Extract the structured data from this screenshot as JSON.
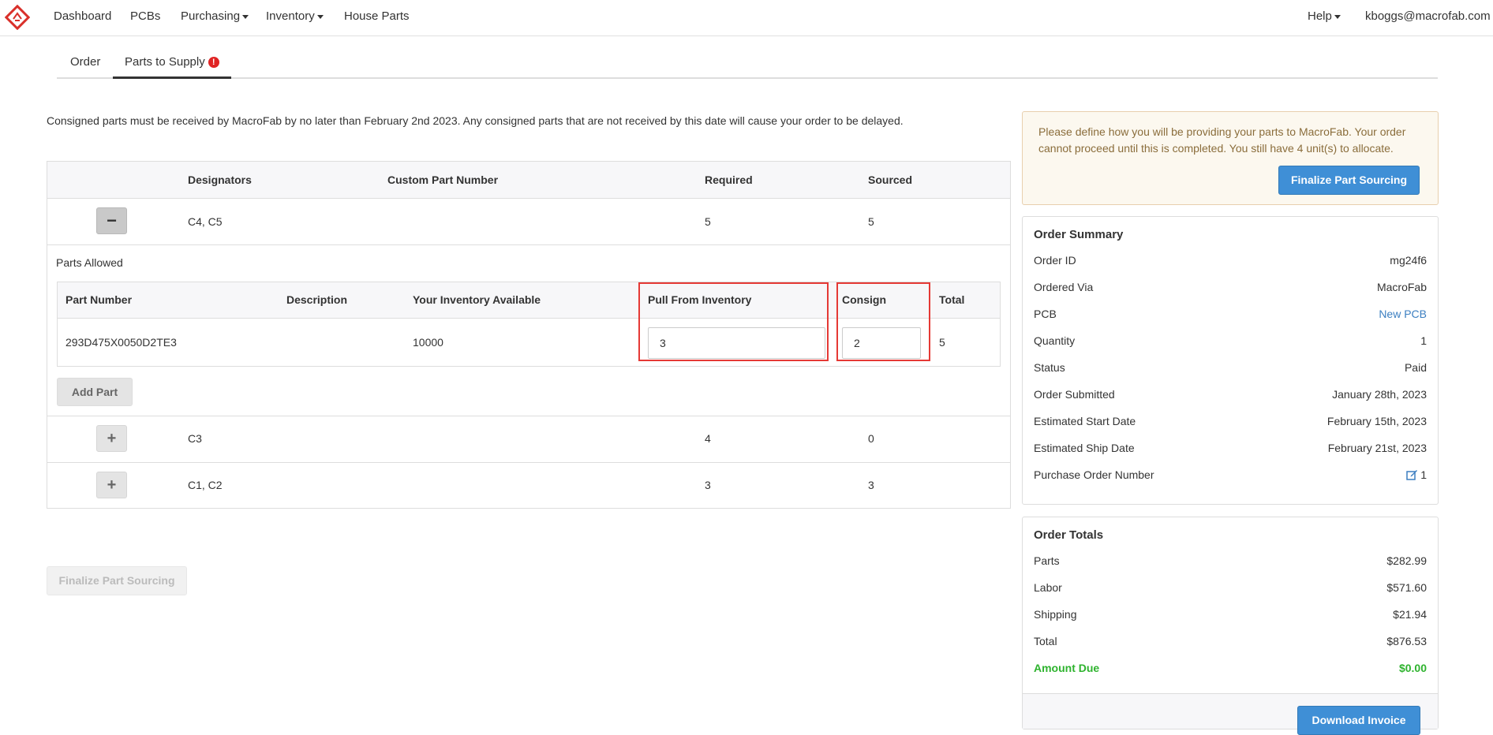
{
  "nav": {
    "items": [
      {
        "label": "Dashboard"
      },
      {
        "label": "PCBs"
      },
      {
        "label": "Purchasing"
      },
      {
        "label": "Inventory"
      },
      {
        "label": "House Parts"
      }
    ],
    "help": "Help",
    "user": "kboggs@macrofab.com"
  },
  "tabs": [
    {
      "label": "Order"
    },
    {
      "label": "Parts to Supply",
      "alert": "!"
    }
  ],
  "notice": "Consigned parts must be received by MacroFab by no later than February 2nd 2023.  Any consigned parts that are not received by this date will cause your order to be delayed.",
  "parts_table": {
    "headers": [
      "Designators",
      "Custom Part Number",
      "Required",
      "Sourced"
    ],
    "rows": [
      {
        "toggle": "−",
        "designators": "C4, C5",
        "custom_part_number": "",
        "required": "5",
        "sourced": "5"
      },
      {
        "toggle": "+",
        "designators": "C3",
        "custom_part_number": "",
        "required": "4",
        "sourced": "0"
      },
      {
        "toggle": "+",
        "designators": "C1, C2",
        "custom_part_number": "",
        "required": "3",
        "sourced": "3"
      }
    ],
    "parts_allowed_label": "Parts Allowed",
    "inner_headers": [
      "Part Number",
      "Description",
      "Your Inventory Available",
      "Pull From Inventory",
      "Consign",
      "Total"
    ],
    "inner_row": {
      "part_number": "293D475X0050D2TE3",
      "description": "",
      "inventory_available": "10000",
      "pull_from_inventory": "3",
      "consign": "2",
      "total": "5"
    },
    "add_part_label": "Add Part"
  },
  "finalize_disabled_label": "Finalize Part Sourcing",
  "warning": {
    "text": "Please define how you will be providing your parts to MacroFab. Your order cannot proceed until this is completed. You still have 4 unit(s) to allocate.",
    "button": "Finalize Part Sourcing"
  },
  "order_summary": {
    "title": "Order Summary",
    "rows": [
      {
        "key": "Order ID",
        "value": "mg24f6"
      },
      {
        "key": "Ordered Via",
        "value": "MacroFab"
      },
      {
        "key": "PCB",
        "value": "New PCB"
      },
      {
        "key": "Quantity",
        "value": "1"
      },
      {
        "key": "Status",
        "value": "Paid"
      },
      {
        "key": "Order Submitted",
        "value": "January 28th, 2023"
      },
      {
        "key": "Estimated Start Date",
        "value": "February 15th, 2023"
      },
      {
        "key": "Estimated Ship Date",
        "value": "February 21st, 2023"
      },
      {
        "key": "Purchase Order Number",
        "value": "1"
      }
    ]
  },
  "order_totals": {
    "title": "Order Totals",
    "rows": [
      {
        "key": "Parts",
        "value": "$282.99"
      },
      {
        "key": "Labor",
        "value": "$571.60"
      },
      {
        "key": "Shipping",
        "value": "$21.94"
      },
      {
        "key": "Total",
        "value": "$876.53"
      },
      {
        "key": "Amount Due",
        "value": "$0.00"
      }
    ],
    "download_button": "Download Invoice"
  },
  "colors": {
    "accent": "#3f8fd6",
    "alert": "#e02424",
    "highlight": "#e53935",
    "success": "#2eb32e",
    "warning_text": "#8a6d3b"
  },
  "icons": [
    "macrofab-logo-icon",
    "caret-down-icon",
    "alert-icon",
    "minus-icon",
    "plus-icon",
    "edit-icon"
  ]
}
